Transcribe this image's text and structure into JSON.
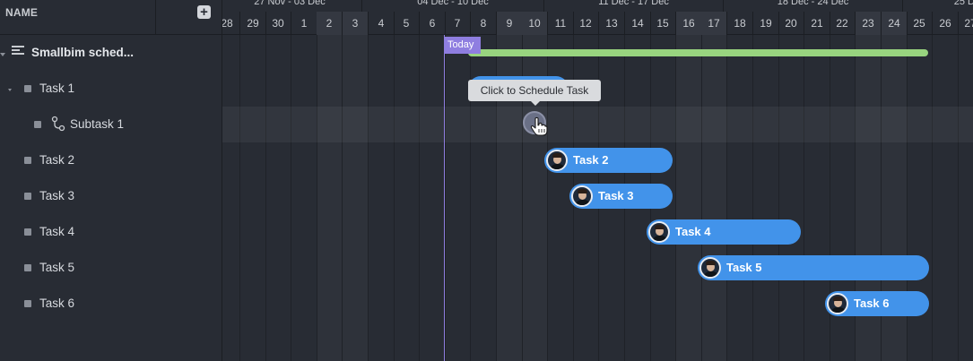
{
  "header": {
    "name_label": "NAME",
    "add_icon": "plus-icon",
    "add_symbol": "+"
  },
  "rows": [
    {
      "label": "Smallbim sched...",
      "type": "project"
    },
    {
      "label": "Task 1",
      "type": "task"
    },
    {
      "label": "Subtask 1",
      "type": "subtask"
    },
    {
      "label": "Task 2",
      "type": "task"
    },
    {
      "label": "Task 3",
      "type": "task"
    },
    {
      "label": "Task 4",
      "type": "task"
    },
    {
      "label": "Task 5",
      "type": "task"
    },
    {
      "label": "Task 6",
      "type": "task"
    }
  ],
  "timeline": {
    "weeks": [
      "27 Nov - 03 Dec",
      "04 Dec - 10 Dec",
      "11 Dec - 17 Dec",
      "18 Dec - 24 Dec",
      "25 D"
    ],
    "days": [
      "28",
      "29",
      "30",
      "1",
      "2",
      "3",
      "4",
      "5",
      "6",
      "7",
      "8",
      "9",
      "10",
      "11",
      "12",
      "13",
      "14",
      "15",
      "16",
      "17",
      "18",
      "19",
      "20",
      "21",
      "22",
      "23",
      "24",
      "25",
      "26",
      "27"
    ],
    "today_label": "Today",
    "tooltip": "Click to Schedule Task"
  },
  "bars": [
    {
      "label": "Task 2"
    },
    {
      "label": "Task 3"
    },
    {
      "label": "Task 4"
    },
    {
      "label": "Task 5"
    },
    {
      "label": "Task 6"
    }
  ],
  "colors": {
    "background": "#282c34",
    "weekend": "#343841",
    "today": "#8f7ee0",
    "summary_bar": "#98d47f",
    "task_bar": "#4293ea",
    "tooltip": "#d9dbde"
  }
}
